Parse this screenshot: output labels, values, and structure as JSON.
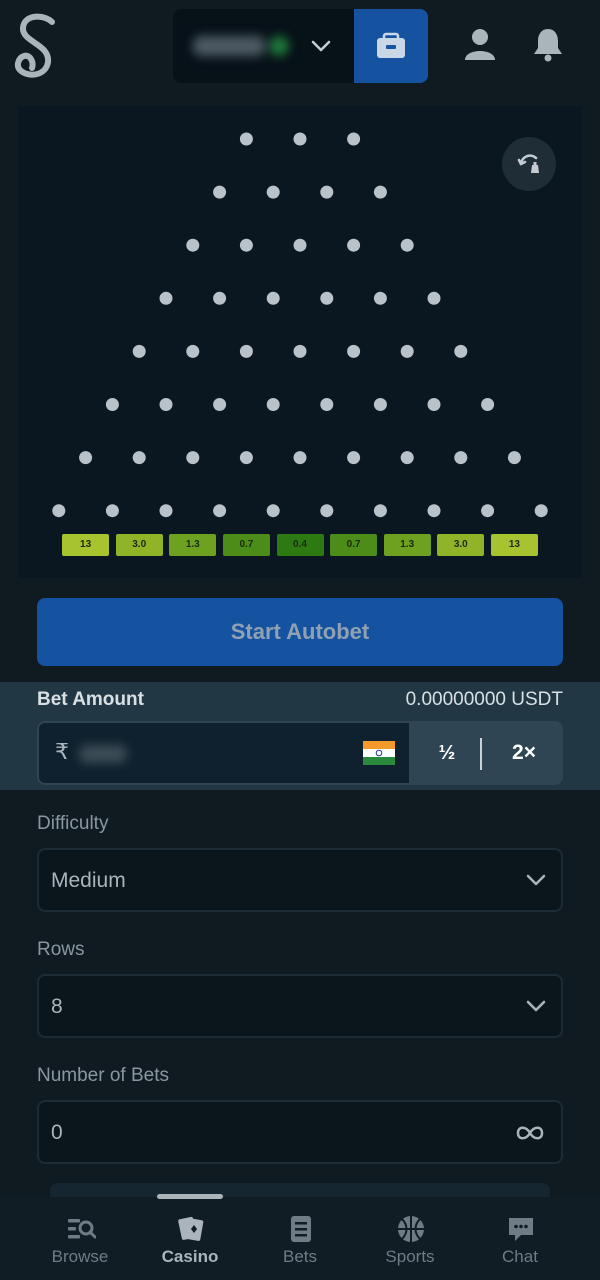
{
  "header": {
    "logo_icon": "stake-s-logo",
    "currency_dropdown_icon": "chevron-down-icon",
    "wallet_icon": "wallet-icon",
    "user_icon": "user-icon",
    "notifications_icon": "bell-icon"
  },
  "game": {
    "rows": 8,
    "multipliers": [
      "13",
      "3.0",
      "1.3",
      "0.7",
      "0.4",
      "0.7",
      "1.3",
      "3.0",
      "13"
    ],
    "multiplier_colors": [
      "#a7c430",
      "#91b328",
      "#6ea11f",
      "#4b8d18",
      "#2e7a12",
      "#4b8d18",
      "#6ea11f",
      "#91b328",
      "#a7c430"
    ],
    "refresh_icon": "refresh-icon"
  },
  "controls": {
    "start_button": "Start Autobet",
    "bet_amount_label": "Bet Amount",
    "bet_amount_usdt": "0.00000000 USDT",
    "currency_symbol": "₹",
    "half_button": "½",
    "double_button": "2×",
    "difficulty_label": "Difficulty",
    "difficulty_value": "Medium",
    "rows_label": "Rows",
    "rows_value": "8",
    "number_of_bets_label": "Number of Bets",
    "number_of_bets_value": "0"
  },
  "nav": {
    "items": [
      {
        "label": "Browse",
        "icon": "browse-icon"
      },
      {
        "label": "Casino",
        "icon": "casino-icon"
      },
      {
        "label": "Bets",
        "icon": "bets-icon"
      },
      {
        "label": "Sports",
        "icon": "sports-icon"
      },
      {
        "label": "Chat",
        "icon": "chat-icon"
      }
    ],
    "active": "Casino"
  },
  "colors": {
    "accent": "#1553a1",
    "background": "#0f1a21",
    "panel": "#213743"
  }
}
